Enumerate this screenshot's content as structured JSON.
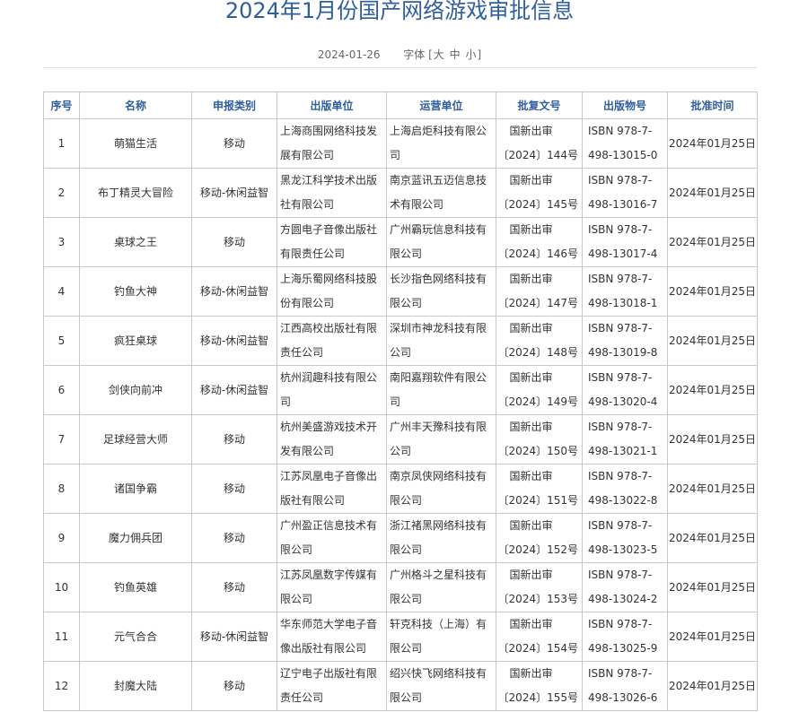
{
  "title": "2024年1月份国产网络游戏审批信息",
  "meta": {
    "date": "2024-01-26",
    "font_label": "字体",
    "bracket": "[",
    "size_large": "大",
    "size_medium": "中",
    "size_small": "小",
    "bracket_close": "]"
  },
  "table": {
    "headers": [
      "序号",
      "名称",
      "申报类别",
      "出版单位",
      "运营单位",
      "批复文号",
      "出版物号",
      "批准时间"
    ],
    "rows": [
      {
        "no": "1",
        "name": "萌猫生活",
        "category": "移动",
        "publisher": "上海商围网络科技发展有限公司",
        "operator": "上海启炬科技有限公司",
        "approval_a": "国新出审",
        "approval_b": "〔2024〕144号",
        "isbn_a": "ISBN 978-7-",
        "isbn_b": "498-13015-0",
        "date": "2024年01月25日"
      },
      {
        "no": "2",
        "name": "布丁精灵大冒险",
        "category": "移动-休闲益智",
        "publisher": "黑龙江科学技术出版社有限公司",
        "operator": "南京蓝讯五迈信息技术有限公司",
        "approval_a": "国新出审",
        "approval_b": "〔2024〕145号",
        "isbn_a": "ISBN 978-7-",
        "isbn_b": "498-13016-7",
        "date": "2024年01月25日"
      },
      {
        "no": "3",
        "name": "桌球之王",
        "category": "移动",
        "publisher": "方圆电子音像出版社有限责任公司",
        "operator": "广州霸玩信息科技有限公司",
        "approval_a": "国新出审",
        "approval_b": "〔2024〕146号",
        "isbn_a": "ISBN 978-7-",
        "isbn_b": "498-13017-4",
        "date": "2024年01月25日"
      },
      {
        "no": "4",
        "name": "钓鱼大神",
        "category": "移动-休闲益智",
        "publisher": "上海乐蜀网络科技股份有限公司",
        "operator": "长沙指色网络科技有限公司",
        "approval_a": "国新出审",
        "approval_b": "〔2024〕147号",
        "isbn_a": "ISBN 978-7-",
        "isbn_b": "498-13018-1",
        "date": "2024年01月25日"
      },
      {
        "no": "5",
        "name": "疯狂桌球",
        "category": "移动-休闲益智",
        "publisher": "江西高校出版社有限责任公司",
        "operator": "深圳市神龙科技有限公司",
        "approval_a": "国新出审",
        "approval_b": "〔2024〕148号",
        "isbn_a": "ISBN 978-7-",
        "isbn_b": "498-13019-8",
        "date": "2024年01月25日"
      },
      {
        "no": "6",
        "name": "剑侠向前冲",
        "category": "移动-休闲益智",
        "publisher": "杭州润趣科技有限公司",
        "operator": "南阳嘉翔软件有限公司",
        "approval_a": "国新出审",
        "approval_b": "〔2024〕149号",
        "isbn_a": "ISBN 978-7-",
        "isbn_b": "498-13020-4",
        "date": "2024年01月25日"
      },
      {
        "no": "7",
        "name": "足球经营大师",
        "category": "移动",
        "publisher": "杭州美盛游戏技术开发有限公司",
        "operator": "广州丰天豫科技有限公司",
        "approval_a": "国新出审",
        "approval_b": "〔2024〕150号",
        "isbn_a": "ISBN 978-7-",
        "isbn_b": "498-13021-1",
        "date": "2024年01月25日"
      },
      {
        "no": "8",
        "name": "诸国争霸",
        "category": "移动",
        "publisher": "江苏凤凰电子音像出版社有限公司",
        "operator": "南京凤侠网络科技有限公司",
        "approval_a": "国新出审",
        "approval_b": "〔2024〕151号",
        "isbn_a": "ISBN 978-7-",
        "isbn_b": "498-13022-8",
        "date": "2024年01月25日"
      },
      {
        "no": "9",
        "name": "魔力佣兵团",
        "category": "移动",
        "publisher": "广州盈正信息技术有限公司",
        "operator": "浙江褚黑网络科技有限公司",
        "approval_a": "国新出审",
        "approval_b": "〔2024〕152号",
        "isbn_a": "ISBN 978-7-",
        "isbn_b": "498-13023-5",
        "date": "2024年01月25日"
      },
      {
        "no": "10",
        "name": "钓鱼英雄",
        "category": "移动",
        "publisher": "江苏凤凰数字传媒有限公司",
        "operator": "广州格斗之星科技有限公司",
        "approval_a": "国新出审",
        "approval_b": "〔2024〕153号",
        "isbn_a": "ISBN 978-7-",
        "isbn_b": "498-13024-2",
        "date": "2024年01月25日"
      },
      {
        "no": "11",
        "name": "元气合合",
        "category": "移动-休闲益智",
        "publisher": "华东师范大学电子音像出版社有限公司",
        "operator": "轩克科技（上海）有限公司",
        "approval_a": "国新出审",
        "approval_b": "〔2024〕154号",
        "isbn_a": "ISBN 978-7-",
        "isbn_b": "498-13025-9",
        "date": "2024年01月25日"
      },
      {
        "no": "12",
        "name": "封魔大陆",
        "category": "移动",
        "publisher": "辽宁电子出版社有限责任公司",
        "operator": "绍兴快飞网络科技有限公司",
        "approval_a": "国新出审",
        "approval_b": "〔2024〕155号",
        "isbn_a": "ISBN 978-7-",
        "isbn_b": "498-13026-6",
        "date": "2024年01月25日"
      }
    ]
  }
}
